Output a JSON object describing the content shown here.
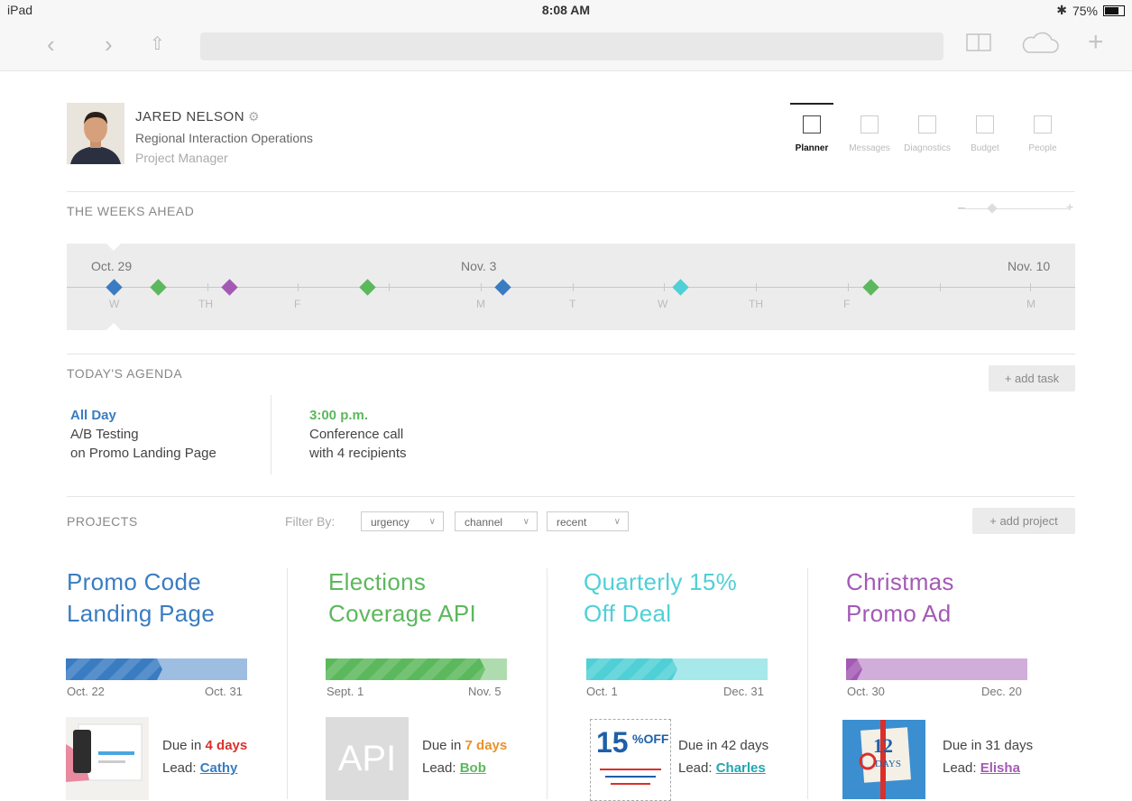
{
  "status_bar": {
    "device": "iPad",
    "time": "8:08 AM",
    "battery": "75%"
  },
  "browser": {
    "back_icon": "chevron-left-icon",
    "forward_icon": "chevron-right-icon",
    "share_icon": "share-icon",
    "bookmarks_icon": "book-icon",
    "cloud_icon": "cloud-icon",
    "new_tab_icon": "plus-icon"
  },
  "profile": {
    "name": "JARED NELSON",
    "department": "Regional Interaction Operations",
    "role": "Project Manager"
  },
  "tabs": [
    {
      "label": "Planner",
      "active": true
    },
    {
      "label": "Messages",
      "active": false
    },
    {
      "label": "Diagnostics",
      "active": false
    },
    {
      "label": "Budget",
      "active": false
    },
    {
      "label": "People",
      "active": false
    }
  ],
  "weeks_ahead": {
    "title": "THE WEEKS AHEAD",
    "dates": [
      "Oct. 29",
      "Nov. 3",
      "Nov. 10"
    ],
    "days": [
      "W",
      "TH",
      "F",
      "M",
      "T",
      "W",
      "TH",
      "F",
      "M"
    ]
  },
  "agenda": {
    "title": "TODAY'S AGENDA",
    "add_task": "+ add task",
    "items": [
      {
        "time": "All Day",
        "line1": "A/B Testing",
        "line2": "on Promo Landing Page",
        "color": "#3a7cc2"
      },
      {
        "time": "3:00 p.m.",
        "line1": "Conference call",
        "line2": "with 4 recipients",
        "color": "#5cb85c"
      }
    ]
  },
  "projects": {
    "title": "PROJECTS",
    "filter_label": "Filter By:",
    "filters": [
      "urgency",
      "channel",
      "recent"
    ],
    "add_project": "+ add project",
    "items": [
      {
        "title_1": "Promo Code",
        "title_2": "Landing Page",
        "color": "#3a7cc2",
        "start": "Oct. 22",
        "end": "Oct. 31",
        "progress": 0.53,
        "due_prefix": "Due in ",
        "due_value": "4 days",
        "due_color": "#d9302b",
        "lead_label": "Lead: ",
        "lead": "Cathy"
      },
      {
        "title_1": "Elections",
        "title_2": "Coverage API",
        "color": "#5cb85c",
        "start": "Sept. 1",
        "end": "Nov. 5",
        "progress": 0.88,
        "due_prefix": "Due in ",
        "due_value": "7 days",
        "due_color": "#e8922a",
        "lead_label": "Lead: ",
        "lead": "Bob",
        "thumb_text": "API"
      },
      {
        "title_1": "Quarterly 15%",
        "title_2": "Off Deal",
        "color": "#4fd0d6",
        "start": "Oct. 1",
        "end": "Dec. 31",
        "progress": 0.5,
        "due_prefix": "Due in ",
        "due_value": "42 days",
        "due_color": "#444444",
        "lead_label": "Lead: ",
        "lead": "Charles"
      },
      {
        "title_1": "Christmas",
        "title_2": "Promo Ad",
        "color": "#a35ab5",
        "start": "Oct. 30",
        "end": "Dec. 20",
        "progress": 0.09,
        "due_prefix": "Due in ",
        "due_value": "31 days",
        "due_color": "#444444",
        "lead_label": "Lead: ",
        "lead": "Elisha"
      }
    ]
  }
}
